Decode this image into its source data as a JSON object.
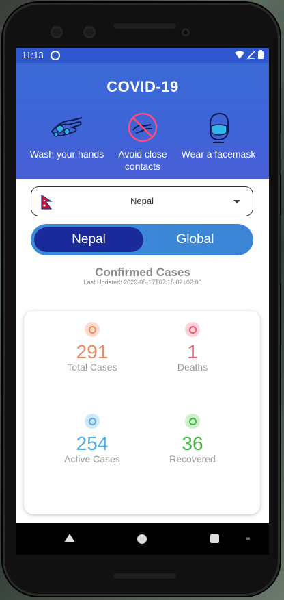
{
  "status_bar": {
    "time": "11:13",
    "icons": [
      "sync-icon",
      "wifi-icon",
      "signal-icon",
      "battery-icon"
    ]
  },
  "app": {
    "title": "COVID-19",
    "header_color": "#3e64d8"
  },
  "tips": [
    {
      "label": "Wash your hands",
      "icon": "hand-wash-icon"
    },
    {
      "label": "Avoid close contacts",
      "icon": "no-handshake-icon"
    },
    {
      "label": "Wear a facemask",
      "icon": "facemask-icon"
    }
  ],
  "country_selector": {
    "selected": "Nepal",
    "flag": "nepal-flag-icon"
  },
  "scope_toggle": {
    "options": [
      "Nepal",
      "Global"
    ],
    "active": "Nepal"
  },
  "confirmed": {
    "title": "Confirmed Cases",
    "last_updated": "Last Updated: 2020-05-17T07:15:02+02:00"
  },
  "stats": [
    {
      "value": "291",
      "label": "Total Cases",
      "color": "#f08a5d",
      "bg": "#fcdccd"
    },
    {
      "value": "1",
      "label": "Deaths",
      "color": "#e85a6c",
      "bg": "#fbd3d8"
    },
    {
      "value": "254",
      "label": "Active Cases",
      "color": "#4aaee8",
      "bg": "#cfe9f8"
    },
    {
      "value": "36",
      "label": "Recovered",
      "color": "#3cb83c",
      "bg": "#cfefcf"
    }
  ]
}
